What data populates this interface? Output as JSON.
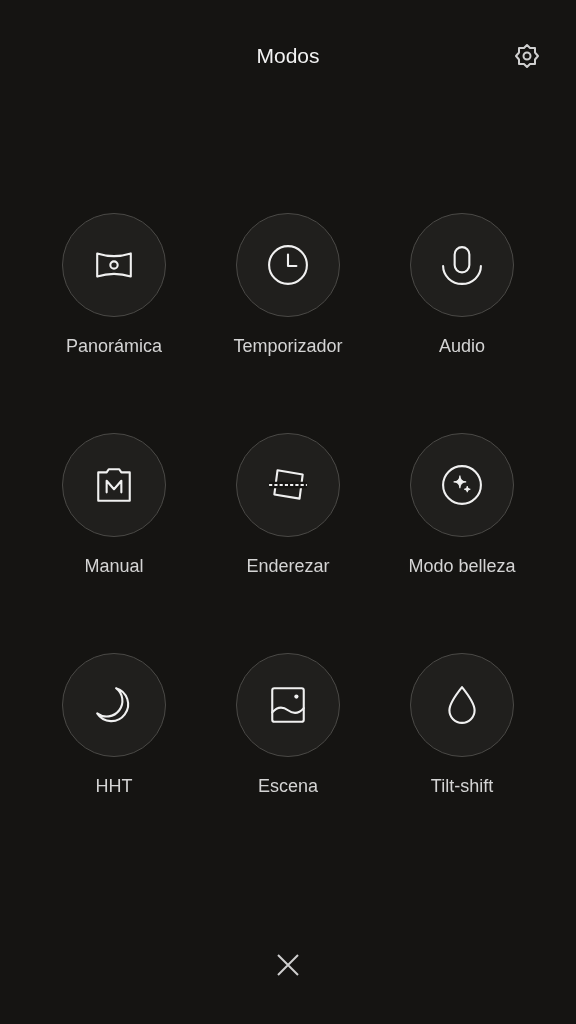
{
  "header": {
    "title": "Modos"
  },
  "modes": [
    {
      "kind": "panorama",
      "label": "Panorámica"
    },
    {
      "kind": "timer",
      "label": "Temporizador"
    },
    {
      "kind": "audio",
      "label": "Audio"
    },
    {
      "kind": "manual",
      "label": "Manual"
    },
    {
      "kind": "straighten",
      "label": "Enderezar"
    },
    {
      "kind": "beauty",
      "label": "Modo belleza"
    },
    {
      "kind": "night",
      "label": "HHT"
    },
    {
      "kind": "scene",
      "label": "Escena"
    },
    {
      "kind": "tiltshift",
      "label": "Tilt-shift"
    }
  ]
}
